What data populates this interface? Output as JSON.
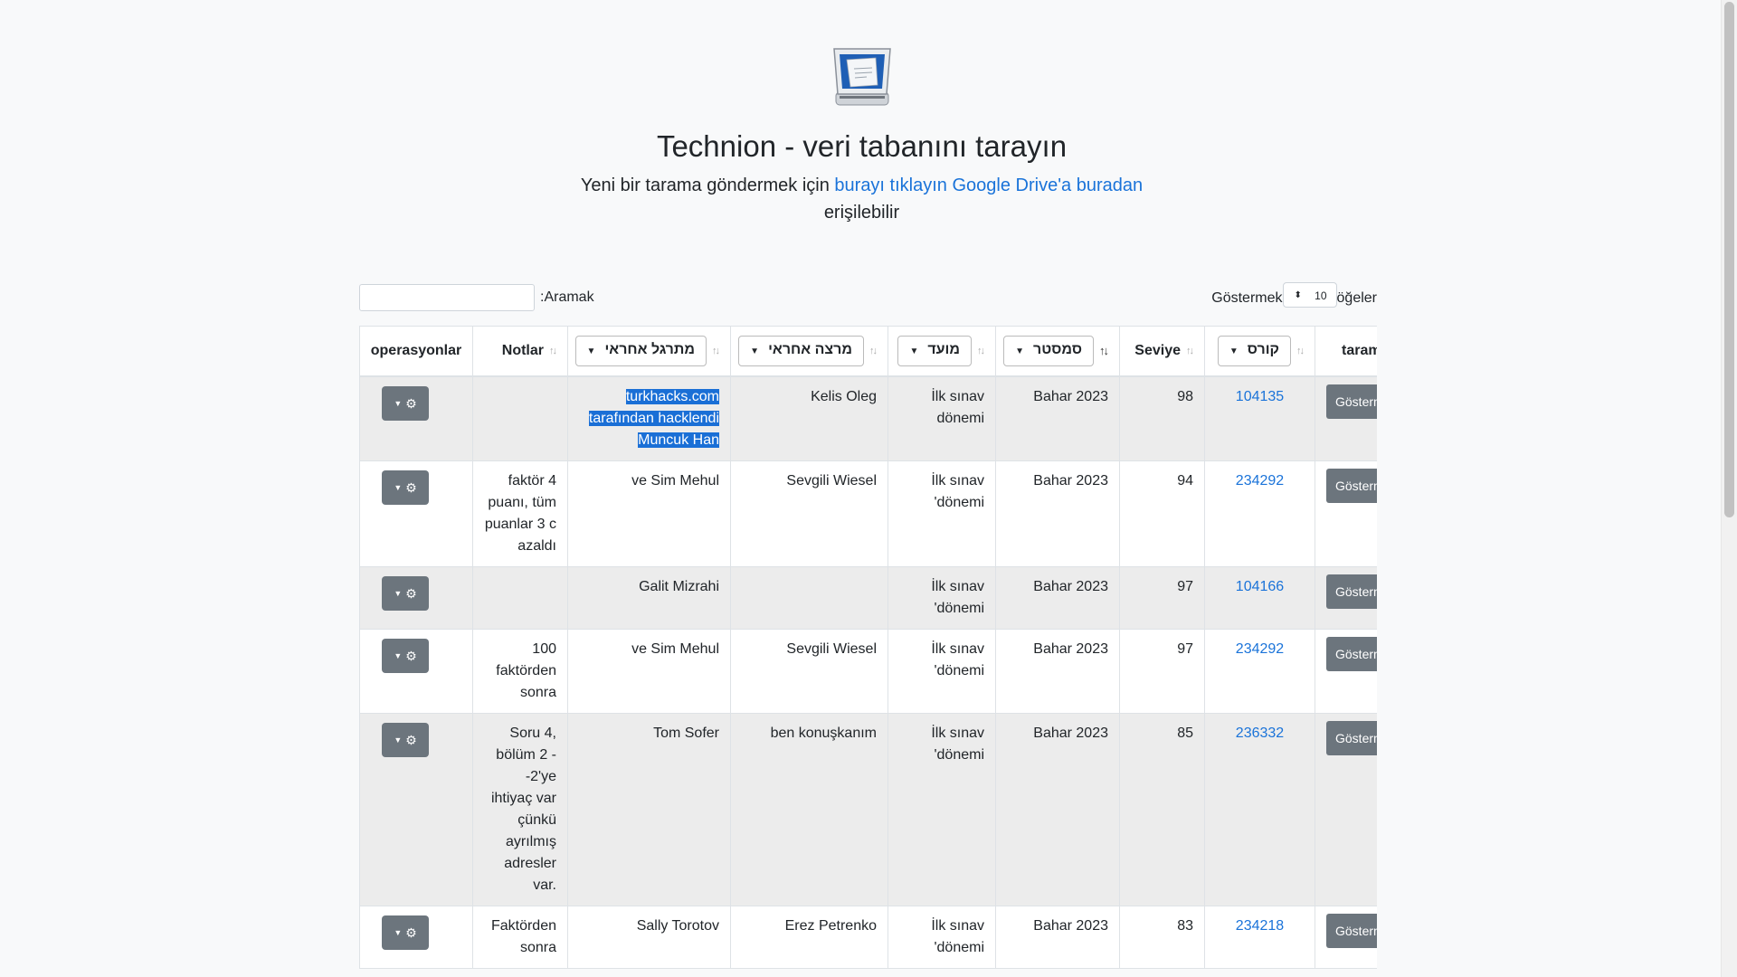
{
  "header": {
    "title": "Technion - veri tabanını tarayın",
    "subtitle_prefix": "Yeni bir tarama göndermek için",
    "link_click": "burayı tıklayın",
    "link_drive": "Google Drive'a buradan",
    "subtitle_suffix": "erişilebilir"
  },
  "controls": {
    "search_label": ":Aramak",
    "show_label": "Göstermek",
    "page_length": "10",
    "items_label": "öğeler"
  },
  "columns": {
    "operations": "operasyonlar",
    "notes": "Notlar",
    "grader": "מתרגל אחראי",
    "lecturer": "מרצה אחראי",
    "deadline": "מועד",
    "semester": "סמסטר",
    "grade": "Seviye",
    "course": "קורס",
    "scan": "taram"
  },
  "rows": [
    {
      "ops": "⚙",
      "notes": "",
      "grader": "turkhacks.com tarafından hacklendi Muncuk Han",
      "lecturer": "Kelis Oleg",
      "deadline": "İlk sınav dönemi",
      "semester": "Bahar 2023",
      "grade": "98",
      "course": "104135",
      "scan": "Gösterm"
    },
    {
      "ops": "⚙",
      "notes": "faktör 4 puanı, tüm puanlar 3 c azaldı",
      "grader": "ve Sim Mehul",
      "lecturer": "Sevgili Wiesel",
      "deadline": "İlk sınav 'dönemi",
      "semester": "Bahar 2023",
      "grade": "94",
      "course": "234292",
      "scan": "Gösterm"
    },
    {
      "ops": "⚙",
      "notes": "",
      "grader": "Galit Mizrahi",
      "lecturer": "",
      "deadline": "İlk sınav 'dönemi",
      "semester": "Bahar 2023",
      "grade": "97",
      "course": "104166",
      "scan": "Gösterm"
    },
    {
      "ops": "⚙",
      "notes": "100 faktörden sonra",
      "grader": "ve Sim Mehul",
      "lecturer": "Sevgili Wiesel",
      "deadline": "İlk sınav 'dönemi",
      "semester": "Bahar 2023",
      "grade": "97",
      "course": "234292",
      "scan": "Gösterm"
    },
    {
      "ops": "⚙",
      "notes": "Soru 4, bölüm 2 - -2'ye ihtiyaç var çünkü ayrılmış adresler var.",
      "grader": "Tom Sofer",
      "lecturer": "ben konuşkanım",
      "deadline": "İlk sınav 'dönemi",
      "semester": "Bahar 2023",
      "grade": "85",
      "course": "236332",
      "scan": "Gösterm"
    },
    {
      "ops": "⚙",
      "notes": "Faktörden sonra",
      "grader": "Sally Torotov",
      "lecturer": "Erez Petrenko",
      "deadline": "İlk sınav 'dönemi",
      "semester": "Bahar 2023",
      "grade": "83",
      "course": "234218",
      "scan": "Gösterm"
    }
  ]
}
